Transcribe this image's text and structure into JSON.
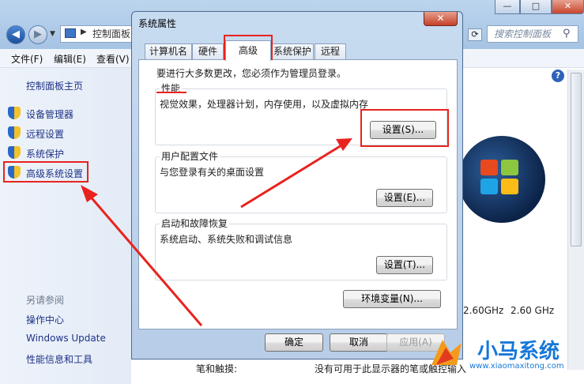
{
  "background": {
    "address_crumb": "控制面板",
    "search_placeholder": "搜索控制面板",
    "window_buttons": {
      "minimize": "—",
      "maximize": "□",
      "close": "✕"
    },
    "menu": [
      "文件(F)",
      "编辑(E)",
      "查看(V)"
    ],
    "sidebar": {
      "home": "控制面板主页",
      "items": [
        "设备管理器",
        "远程设置",
        "系统保护",
        "高级系统设置"
      ],
      "see_also_title": "另请参阅",
      "see_also": [
        "操作中心",
        "Windows Update",
        "性能信息和工具"
      ]
    },
    "cpu_speed_1": "2.60GHz",
    "cpu_speed_2": "2.60 GHz",
    "pen_touch_label": "笔和触摸:",
    "pen_touch_value": "没有可用于此显示器的笔或触控输入"
  },
  "dialog": {
    "title": "系统属性",
    "close": "✕",
    "tabs": [
      "计算机名",
      "硬件",
      "高级",
      "系统保护",
      "远程"
    ],
    "selected_tab": "高级",
    "admin_note": "要进行大多数更改，您必须作为管理员登录。",
    "groups": [
      {
        "title": "性能",
        "desc": "视觉效果，处理器计划，内存使用，以及虚拟内存",
        "button": "设置(S)..."
      },
      {
        "title": "用户配置文件",
        "desc": "与您登录有关的桌面设置",
        "button": "设置(E)..."
      },
      {
        "title": "启动和故障恢复",
        "desc": "系统启动、系统失败和调试信息",
        "button": "设置(T)..."
      }
    ],
    "env_button": "环境变量(N)...",
    "ok": "确定",
    "cancel": "取消",
    "apply": "应用(A)"
  },
  "watermark": {
    "text": "小马系统",
    "url": "www.xiaomaxitong.com"
  },
  "colors": {
    "annotation_red": "#e8231e",
    "link_blue": "#1e3287"
  }
}
